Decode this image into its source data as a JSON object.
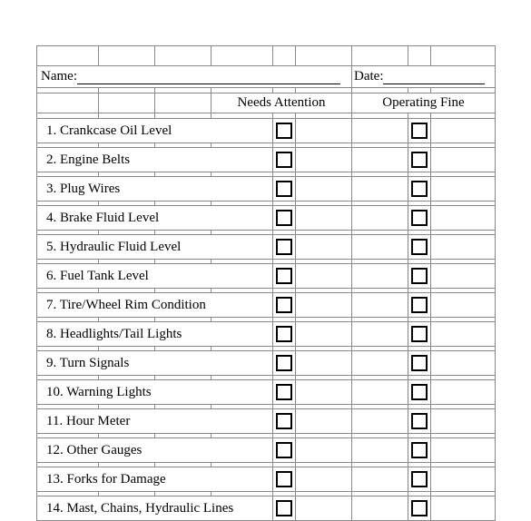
{
  "form": {
    "name_label": "Name:",
    "date_label": "Date:"
  },
  "headers": {
    "needs_attention": "Needs Attention",
    "operating_fine": "Operating Fine"
  },
  "items": [
    {
      "num": "1.",
      "label": "Crankcase Oil Level"
    },
    {
      "num": "2.",
      "label": "Engine Belts"
    },
    {
      "num": "3.",
      "label": "Plug Wires"
    },
    {
      "num": "4.",
      "label": "Brake Fluid Level"
    },
    {
      "num": "5.",
      "label": "Hydraulic Fluid Level"
    },
    {
      "num": "6.",
      "label": "Fuel Tank Level"
    },
    {
      "num": "7.",
      "label": "Tire/Wheel Rim Condition"
    },
    {
      "num": "8.",
      "label": "Headlights/Tail Lights"
    },
    {
      "num": "9.",
      "label": "Turn Signals"
    },
    {
      "num": "10.",
      "label": "Warning Lights"
    },
    {
      "num": "11.",
      "label": "Hour Meter"
    },
    {
      "num": "12.",
      "label": "Other Gauges"
    },
    {
      "num": "13.",
      "label": "Forks for Damage"
    },
    {
      "num": "14.",
      "label": "Mast, Chains, Hydraulic Lines"
    }
  ]
}
